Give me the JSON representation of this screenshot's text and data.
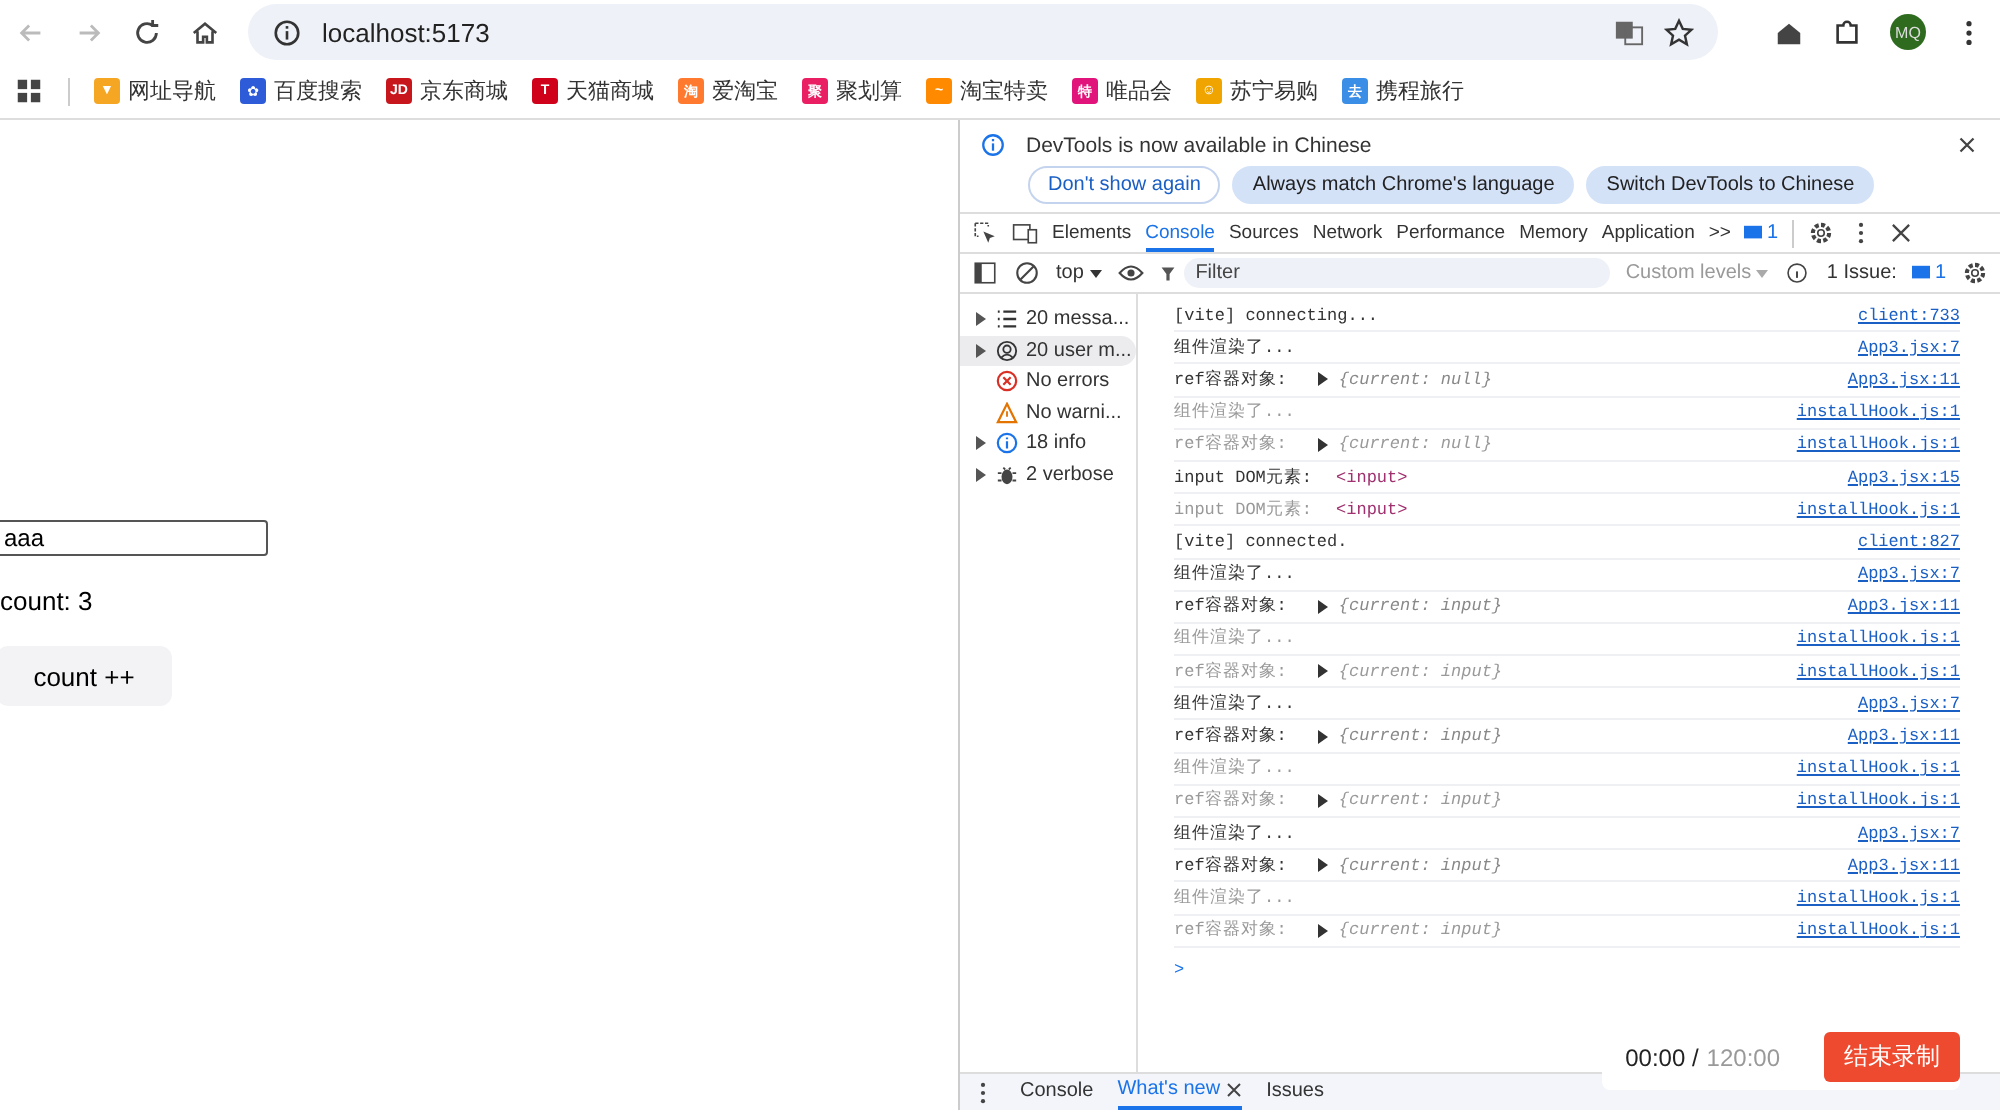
{
  "browser": {
    "url": "localhost:5173",
    "avatar": "MQ"
  },
  "bookmarks": [
    {
      "label": "网址导航",
      "color": "#f5a623",
      "glyph": "▼"
    },
    {
      "label": "百度搜索",
      "color": "#2e5bd8",
      "glyph": "✿"
    },
    {
      "label": "京东商城",
      "color": "#c8161d",
      "glyph": "JD"
    },
    {
      "label": "天猫商城",
      "color": "#d0021b",
      "glyph": "T"
    },
    {
      "label": "爱淘宝",
      "color": "#ff7a2e",
      "glyph": "淘"
    },
    {
      "label": "聚划算",
      "color": "#e91e63",
      "glyph": "聚"
    },
    {
      "label": "淘宝特卖",
      "color": "#ff8a00",
      "glyph": "~"
    },
    {
      "label": "唯品会",
      "color": "#e0147a",
      "glyph": "特"
    },
    {
      "label": "苏宁易购",
      "color": "#f0a400",
      "glyph": "☺"
    },
    {
      "label": "携程旅行",
      "color": "#3a8ee6",
      "glyph": "去"
    }
  ],
  "page": {
    "input_value": "aaa",
    "count_text": "count: 3",
    "button": "count ++"
  },
  "devtools": {
    "infobar": {
      "message": "DevTools is now available in Chinese",
      "buttons": [
        {
          "label": "Don't show again",
          "kind": "outline"
        },
        {
          "label": "Always match Chrome's language",
          "kind": "filled"
        },
        {
          "label": "Switch DevTools to Chinese",
          "kind": "filled"
        }
      ]
    },
    "tabs": [
      {
        "label": "Elements",
        "selected": false
      },
      {
        "label": "Console",
        "selected": true
      },
      {
        "label": "Sources",
        "selected": false
      },
      {
        "label": "Network",
        "selected": false
      },
      {
        "label": "Performance",
        "selected": false
      },
      {
        "label": "Memory",
        "selected": false
      },
      {
        "label": "Application",
        "selected": false
      }
    ],
    "overflow": ">>",
    "message_badge": "1",
    "toolbar": {
      "context": "top",
      "filter_placeholder": "Filter",
      "levels": "Custom levels",
      "issues_label": "1 Issue:",
      "issues_count": "1"
    },
    "sidebar": [
      {
        "label": "20 messa...",
        "kind": "list",
        "expandable": true,
        "selected": false
      },
      {
        "label": "20 user m...",
        "kind": "user",
        "expandable": true,
        "selected": true
      },
      {
        "label": "No errors",
        "kind": "error",
        "expandable": false,
        "selected": false
      },
      {
        "label": "No warni...",
        "kind": "warning",
        "expandable": false,
        "selected": false
      },
      {
        "label": "18 info",
        "kind": "info",
        "expandable": true,
        "selected": false
      },
      {
        "label": "2 verbose",
        "kind": "verbose",
        "expandable": true,
        "selected": false
      }
    ],
    "messages": [
      {
        "text": "[vite] connecting...",
        "dim": false,
        "source": "client:733"
      },
      {
        "text": "组件渲染了...",
        "dim": false,
        "source": "App3.jsx:7"
      },
      {
        "text": "ref容器对象:",
        "dim": false,
        "object": "{current: null}",
        "source": "App3.jsx:11"
      },
      {
        "text": "组件渲染了...",
        "dim": true,
        "source": "installHook.js:1"
      },
      {
        "text": "ref容器对象:",
        "dim": true,
        "object": "{current: null}",
        "source": "installHook.js:1"
      },
      {
        "text": "input DOM元素:",
        "dim": false,
        "element": "<input>",
        "source": "App3.jsx:15"
      },
      {
        "text": "input DOM元素:",
        "dim": true,
        "element": "<input>",
        "source": "installHook.js:1"
      },
      {
        "text": "[vite] connected.",
        "dim": false,
        "source": "client:827"
      },
      {
        "text": "组件渲染了...",
        "dim": false,
        "source": "App3.jsx:7"
      },
      {
        "text": "ref容器对象:",
        "dim": false,
        "object": "{current: input}",
        "source": "App3.jsx:11"
      },
      {
        "text": "组件渲染了...",
        "dim": true,
        "source": "installHook.js:1"
      },
      {
        "text": "ref容器对象:",
        "dim": true,
        "object": "{current: input}",
        "source": "installHook.js:1"
      },
      {
        "text": "组件渲染了...",
        "dim": false,
        "source": "App3.jsx:7"
      },
      {
        "text": "ref容器对象:",
        "dim": false,
        "object": "{current: input}",
        "source": "App3.jsx:11"
      },
      {
        "text": "组件渲染了...",
        "dim": true,
        "source": "installHook.js:1"
      },
      {
        "text": "ref容器对象:",
        "dim": true,
        "object": "{current: input}",
        "source": "installHook.js:1"
      },
      {
        "text": "组件渲染了...",
        "dim": false,
        "source": "App3.jsx:7"
      },
      {
        "text": "ref容器对象:",
        "dim": false,
        "object": "{current: input}",
        "source": "App3.jsx:11"
      },
      {
        "text": "组件渲染了...",
        "dim": true,
        "source": "installHook.js:1"
      },
      {
        "text": "ref容器对象:",
        "dim": true,
        "object": "{current: input}",
        "source": "installHook.js:1"
      }
    ],
    "prompt": ">",
    "drawer_tabs": [
      {
        "label": "Console",
        "selected": false,
        "closable": false
      },
      {
        "label": "What's new",
        "selected": true,
        "closable": true
      },
      {
        "label": "Issues",
        "selected": false,
        "closable": false
      }
    ]
  },
  "recorder": {
    "elapsed": "00:00 /",
    "limit": "120:00",
    "stop_button": "结束录制"
  }
}
